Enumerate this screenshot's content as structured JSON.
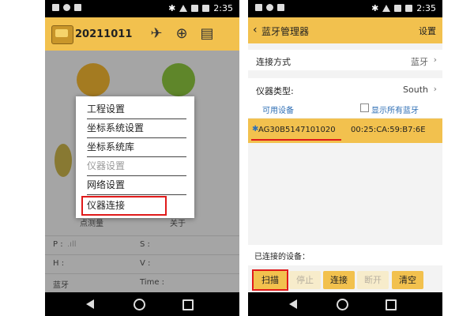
{
  "left_phone": {
    "status_bar": {
      "time": "2:35"
    },
    "toolbar": {
      "title": "20211011",
      "logo_icon": "app-logo-icon",
      "icons": [
        "satellite-icon",
        "compass-add-icon",
        "data-window-icon"
      ]
    },
    "app_grid": [
      {
        "icon": "folder-icon",
        "color": "#f2b632"
      },
      {
        "icon": "gear-icon",
        "color": "#8cc63e"
      }
    ],
    "bottom_labels": [
      "点测量",
      "关于"
    ],
    "info_rows": [
      {
        "left": "P :",
        "right": "S :"
      },
      {
        "left": "H :",
        "right": "V :"
      },
      {
        "left": "蓝牙",
        "right": "Time :"
      }
    ],
    "menu": {
      "items": [
        {
          "label": "工程设置",
          "enabled": true
        },
        {
          "label": "坐标系统设置",
          "enabled": true
        },
        {
          "label": "坐标系统库",
          "enabled": true
        },
        {
          "label": "仪器设置",
          "enabled": false
        },
        {
          "label": "网络设置",
          "enabled": true
        },
        {
          "label": "仪器连接",
          "enabled": true,
          "highlighted": true
        }
      ]
    }
  },
  "right_phone": {
    "status_bar": {
      "time": "2:35"
    },
    "toolbar": {
      "title": "蓝牙管理器",
      "settings_label": "设置"
    },
    "connection_method": {
      "label": "连接方式",
      "value": "蓝牙"
    },
    "instrument_type": {
      "label": "仪器类型:",
      "value": "South"
    },
    "available_devices_label": "可用设备",
    "show_all_bluetooth": {
      "label": "显示所有蓝牙",
      "checked": false
    },
    "devices": [
      {
        "name": "AG30B5147101020",
        "mac": "00:25:CA:59:B7:6E"
      }
    ],
    "connected_devices_label": "已连接的设备：",
    "buttons": [
      {
        "label": "扫描",
        "enabled": true,
        "highlighted": true
      },
      {
        "label": "停止",
        "enabled": false
      },
      {
        "label": "连接",
        "enabled": true
      },
      {
        "label": "断开",
        "enabled": false
      },
      {
        "label": "清空",
        "enabled": true
      }
    ]
  },
  "colors": {
    "accent": "#f2c14e",
    "highlight_red": "#e01a1a"
  }
}
